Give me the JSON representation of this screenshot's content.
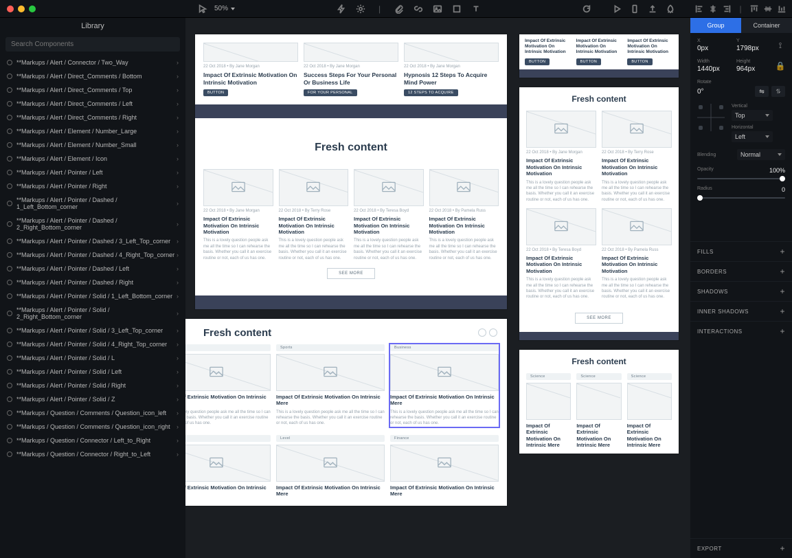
{
  "topbar": {
    "zoom_label": "50%"
  },
  "library": {
    "title": "Library",
    "search_placeholder": "Search Components",
    "item_prefix": "**Markups / ",
    "items": [
      "Alert / Connector / Two_Way",
      "Alert / Direct_Comments / Bottom",
      "Alert / Direct_Comments / Top",
      "Alert / Direct_Comments / Left",
      "Alert / Direct_Comments / Right",
      "Alert / Element / Number_Large",
      "Alert / Element / Number_Small",
      "Alert / Element / Icon",
      "Alert / Pointer / Left",
      "Alert / Pointer / Right",
      "Alert / Pointer / Dashed / 1_Left_Bottom_corner",
      "Alert / Pointer / Dashed / 2_Right_Bottom_corner",
      "Alert / Pointer / Dashed / 3_Left_Top_corner",
      "Alert / Pointer / Dashed / 4_Right_Top_corner",
      "Alert / Pointer / Dashed / Left",
      "Alert / Pointer / Dashed / Right",
      "Alert / Pointer / Solid / 1_Left_Bottom_corner",
      "Alert / Pointer / Solid / 2_Right_Bottom_corner",
      "Alert / Pointer / Solid / 3_Left_Top_corner",
      "Alert / Pointer / Solid / 4_Right_Top_corner",
      "Alert / Pointer / Solid / L",
      "Alert / Pointer / Solid / Left",
      "Alert / Pointer / Solid / Right",
      "Alert / Pointer / Solid / Z",
      "Question / Comments / Question_icon_left",
      "Question / Comments / Question_icon_right",
      "Question / Connector / Left_to_Right",
      "Question / Connector / Right_to_Left"
    ]
  },
  "canvas": {
    "section_title": "Fresh content",
    "article_title": "Impact Of Extrinsic Motivation On Intrinsic Motivation",
    "article_title_short": "Impact Of Extrinsic Motivation On Intrinsic Mere",
    "hero1": "Impact Of Extrinsic Motivation On Intrinsic Motivation",
    "hero2": "Success Steps For Your Personal Or Business Life",
    "hero3": "Hypnosis 12 Steps To Acquire Mind Power",
    "tag_button": "BUTTON",
    "tag_personal": "FOR YOUR PERSONAL",
    "tag_steps": "12 STEPS TO ACQUIRE",
    "meta": "22 Oct 2018   •   By   Jane Morgan",
    "meta_alt1": "22 Oct 2018   •   By   Terry Rose",
    "meta_alt2": "22 Oct 2018   •   By   Teresa Boyd",
    "meta_alt3": "22 Oct 2018   •   By   Pamela Russ",
    "desc": "This is a lovely question people ask me all the time so I can rehearse the basis. Whether you call it an exercise routine or not, each of us has one.",
    "see_more": "SEE MORE",
    "card_label_business": "Business",
    "card_label_science": "Science",
    "card_label_sports": "Sports",
    "card_label_level": "Level",
    "card_label_finance": "Finance"
  },
  "inspector": {
    "tabs": {
      "group": "Group",
      "container": "Container"
    },
    "x": {
      "label": "X",
      "value": "0px"
    },
    "y": {
      "label": "Y",
      "value": "1798px"
    },
    "width": {
      "label": "Width",
      "value": "1440px"
    },
    "height": {
      "label": "Height",
      "value": "964px"
    },
    "rotate": {
      "label": "Rotate",
      "value": "0°"
    },
    "align_v": {
      "label": "Vertical",
      "value": "Top"
    },
    "align_h": {
      "label": "Horizontal",
      "value": "Left"
    },
    "blending": {
      "label": "Blending",
      "value": "Normal"
    },
    "opacity": {
      "label": "Opacity",
      "value": "100%"
    },
    "radius": {
      "label": "Radius",
      "value": "0"
    },
    "sections": [
      "FILLS",
      "BORDERS",
      "SHADOWS",
      "INNER SHADOWS",
      "INTERACTIONS"
    ],
    "export": "EXPORT"
  }
}
